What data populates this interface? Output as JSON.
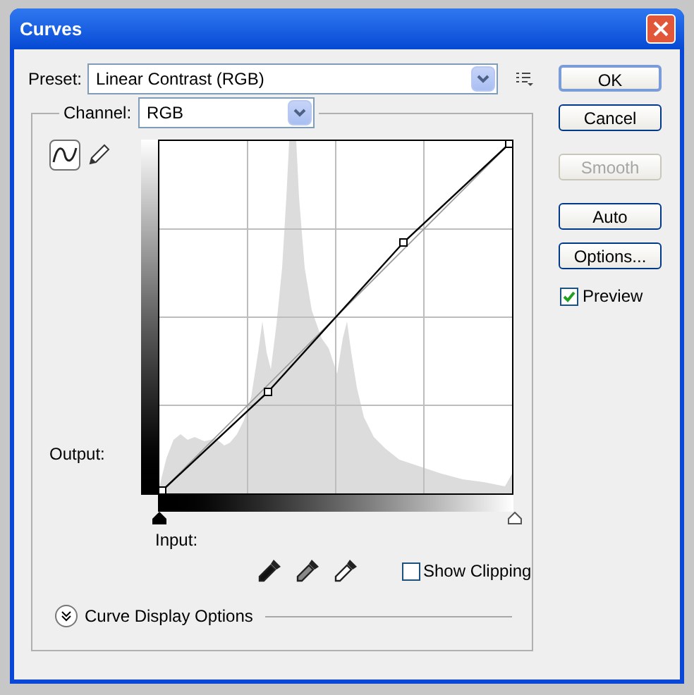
{
  "window": {
    "title": "Curves"
  },
  "preset": {
    "label": "Preset:",
    "value": "Linear Contrast (RGB)"
  },
  "channel": {
    "label": "Channel:",
    "value": "RGB"
  },
  "tools": [
    {
      "kind": "curve",
      "selected": true
    },
    {
      "kind": "pencil",
      "selected": false
    }
  ],
  "output_label": "Output:",
  "input_label": "Input:",
  "show_clipping": {
    "label": "Show Clipping",
    "checked": false
  },
  "curve_display_options": {
    "label": "Curve Display Options",
    "expanded": false
  },
  "buttons": [
    {
      "label": "OK",
      "disabled": false,
      "default": true
    },
    {
      "label": "Cancel",
      "disabled": false,
      "default": false
    },
    {
      "label": "Smooth",
      "disabled": true,
      "default": false
    },
    {
      "label": "Auto",
      "disabled": false,
      "default": false
    },
    {
      "label": "Options...",
      "disabled": false,
      "default": false
    }
  ],
  "preview": {
    "label": "Preview",
    "checked": true
  }
}
